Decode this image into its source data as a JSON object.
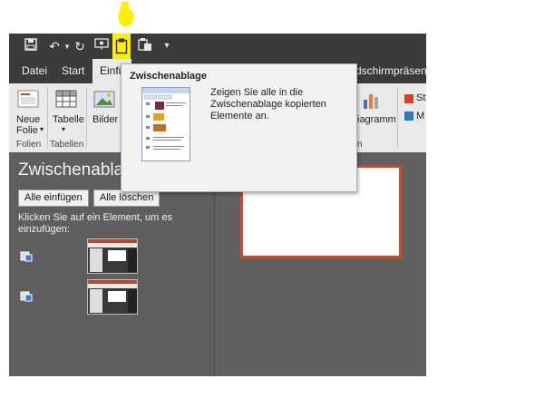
{
  "tabs": [
    "Datei",
    "Start",
    "Einfü",
    "dschirmpräsentat"
  ],
  "ribbon": {
    "neue_folie": [
      "Neue",
      "Folie"
    ],
    "tabelle": "Tabelle",
    "bilder": "Bilder",
    "diagramm": "iagramm",
    "st": "St",
    "m": "M",
    "groups": {
      "folien": "Folien",
      "tabellen": "Tabellen",
      "n": "n"
    }
  },
  "panel": {
    "title": "Zwischenablage",
    "paste_all": "Alle einfügen",
    "clear_all": "Alle löschen",
    "hint": "Klicken Sie auf ein Element, um es einzufügen:"
  },
  "tooltip": {
    "title": "Zwischenablage",
    "description": "Zeigen Sie alle in die Zwischenablage kopierten Elemente an."
  },
  "colors": {
    "highlight": "#ffee00",
    "slide_border": "#d24726",
    "title_bar": "#3b3b3b"
  },
  "icons": [
    "save-icon",
    "undo-icon",
    "redo-icon",
    "start-from-beginning-icon",
    "clipboard-icon",
    "paste-special-icon",
    "customize-qat-icon"
  ]
}
